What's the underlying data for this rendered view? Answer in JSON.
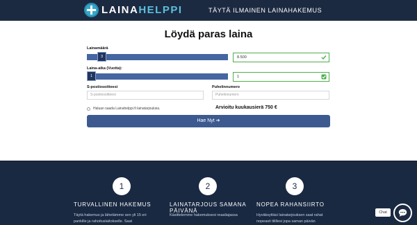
{
  "header": {
    "logo_text_a": "LAINA",
    "logo_text_b": "HELPPI",
    "cta": "TÄYTÄ ILMAINEN LAINAHAKEMUS"
  },
  "form": {
    "title": "Löydä paras laina",
    "amount": {
      "label": "Lainamäärä",
      "thumb": "3",
      "value": "8.500",
      "fill_fraction": 0.08
    },
    "duration": {
      "label": "Laina-aika (Vuotta):",
      "thumb": "1",
      "value": "1",
      "fill_fraction": 0.0
    },
    "email": {
      "label": "S-postiosoitteesi",
      "placeholder": "S-postiosoitteesi"
    },
    "phone": {
      "label": "Puhelinnumero",
      "placeholder": "Puhelinnumero"
    },
    "optin_text": "Haluan saada Lainahelppi.fi lainatarjouksia.",
    "estimate_text": "Arvioitu kuukausierä 750 €",
    "submit_label": "Hae Nyt ➔"
  },
  "steps": [
    {
      "number": "1",
      "title": "TURVALLINEN HAKEMUS",
      "body": "Täytä hakemus ja lähetämme sen yli 15 eri pankille ja rahoituslaitokselle. Saat"
    },
    {
      "number": "2",
      "title": "LAINATARJOUS SAMANA PÄIVÄNÄ",
      "body": "Käsittelemme hakemuksesi reaaliajassa"
    },
    {
      "number": "3",
      "title": "NOPEA RAHANSIIRTO",
      "body": "Hyväksyttäsi lainatarjouksen saat rahat nopeasti tilillesi jopa saman päivän"
    }
  ],
  "chat": {
    "label": "Chat"
  },
  "colors": {
    "navy": "#1a2942",
    "accent": "#3c5a8f",
    "valid": "#4cae4c"
  }
}
